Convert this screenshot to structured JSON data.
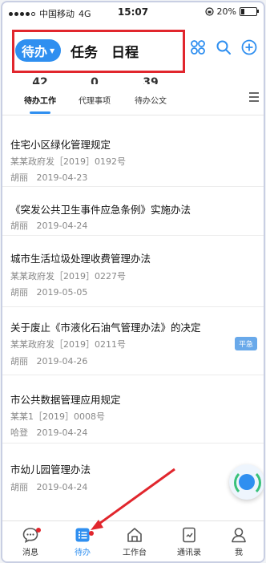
{
  "status": {
    "carrier": "中国移动",
    "network": "4G",
    "time": "15:07",
    "battery": "20%",
    "battery_level": 0.2
  },
  "header": {
    "tabs": [
      {
        "label": "待办",
        "active": true
      },
      {
        "label": "任务",
        "active": false
      },
      {
        "label": "日程",
        "active": false
      }
    ]
  },
  "stats": [
    {
      "count": "42",
      "label": "待办工作"
    },
    {
      "count": "0",
      "label": "代理事项"
    },
    {
      "count": "39",
      "label": "待办公文"
    }
  ],
  "items": [
    {
      "title": "住宅小区绿化管理规定",
      "doc": "某某政府发［2019］0192号",
      "person": "胡丽",
      "date": "2019-04-23",
      "badge": ""
    },
    {
      "title": "《突发公共卫生事件应急条例》实施办法",
      "doc": "",
      "person": "胡丽",
      "date": "2019-04-24",
      "badge": ""
    },
    {
      "title": "城市生活垃圾处理收费管理办法",
      "doc": "某某政府发［2019］0227号",
      "person": "胡丽",
      "date": "2019-05-05",
      "badge": ""
    },
    {
      "title": "关于废止《市液化石油气管理办法》的决定",
      "doc": "某某政府发［2019］0211号",
      "person": "胡丽",
      "date": "2019-04-26",
      "badge": "平急"
    },
    {
      "title": "市公共数据管理应用规定",
      "doc": "某某1［2019］0008号",
      "person": "哈登",
      "date": "2019-04-24",
      "badge": ""
    },
    {
      "title": "市幼儿园管理办法",
      "doc": "",
      "person": "胡丽",
      "date": "2019-04-24",
      "badge": ""
    }
  ],
  "nav": [
    {
      "label": "消息"
    },
    {
      "label": "待办"
    },
    {
      "label": "工作台"
    },
    {
      "label": "通讯录"
    },
    {
      "label": "我"
    }
  ],
  "colors": {
    "accent": "#2f8ff0",
    "highlight": "#e1262d"
  }
}
